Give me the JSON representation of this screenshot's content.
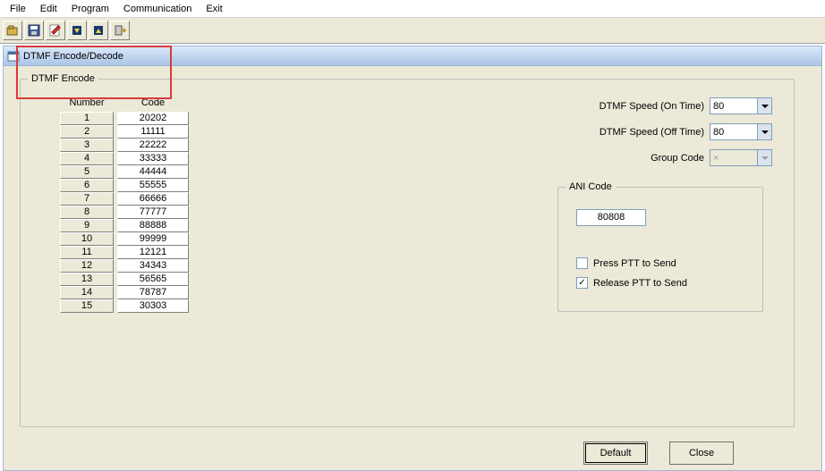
{
  "menu": {
    "items": [
      "File",
      "Edit",
      "Program",
      "Communication",
      "Exit"
    ]
  },
  "toolbar": {
    "icons": [
      "open-icon",
      "save-icon",
      "write-icon",
      "read-down-icon",
      "read-up-icon",
      "exit-icon"
    ]
  },
  "tab": {
    "title": "DTMF Encode/Decode"
  },
  "group_main": {
    "legend": "DTMF Encode"
  },
  "table": {
    "headers": {
      "number": "Number",
      "code": "Code"
    },
    "rows": [
      {
        "n": "1",
        "c": "20202"
      },
      {
        "n": "2",
        "c": "11111"
      },
      {
        "n": "3",
        "c": "22222"
      },
      {
        "n": "4",
        "c": "33333"
      },
      {
        "n": "5",
        "c": "44444"
      },
      {
        "n": "6",
        "c": "55555"
      },
      {
        "n": "7",
        "c": "66666"
      },
      {
        "n": "8",
        "c": "77777"
      },
      {
        "n": "9",
        "c": "88888"
      },
      {
        "n": "10",
        "c": "99999"
      },
      {
        "n": "11",
        "c": "12121"
      },
      {
        "n": "12",
        "c": "34343"
      },
      {
        "n": "13",
        "c": "56565"
      },
      {
        "n": "14",
        "c": "78787"
      },
      {
        "n": "15",
        "c": "30303"
      }
    ]
  },
  "right": {
    "on_time": {
      "label": "DTMF Speed (On Time)",
      "value": "80"
    },
    "off_time": {
      "label": "DTMF Speed (Off Time)",
      "value": "80"
    },
    "group_code": {
      "label": "Group Code",
      "value": "×"
    }
  },
  "ani": {
    "legend": "ANI Code",
    "value": "80808",
    "press_label": "Press PTT to Send",
    "press_checked": false,
    "release_label": "Release PTT to Send",
    "release_checked": true
  },
  "buttons": {
    "default": "Default",
    "close": "Close"
  },
  "colors": {
    "highlight": "#d83b3b"
  }
}
